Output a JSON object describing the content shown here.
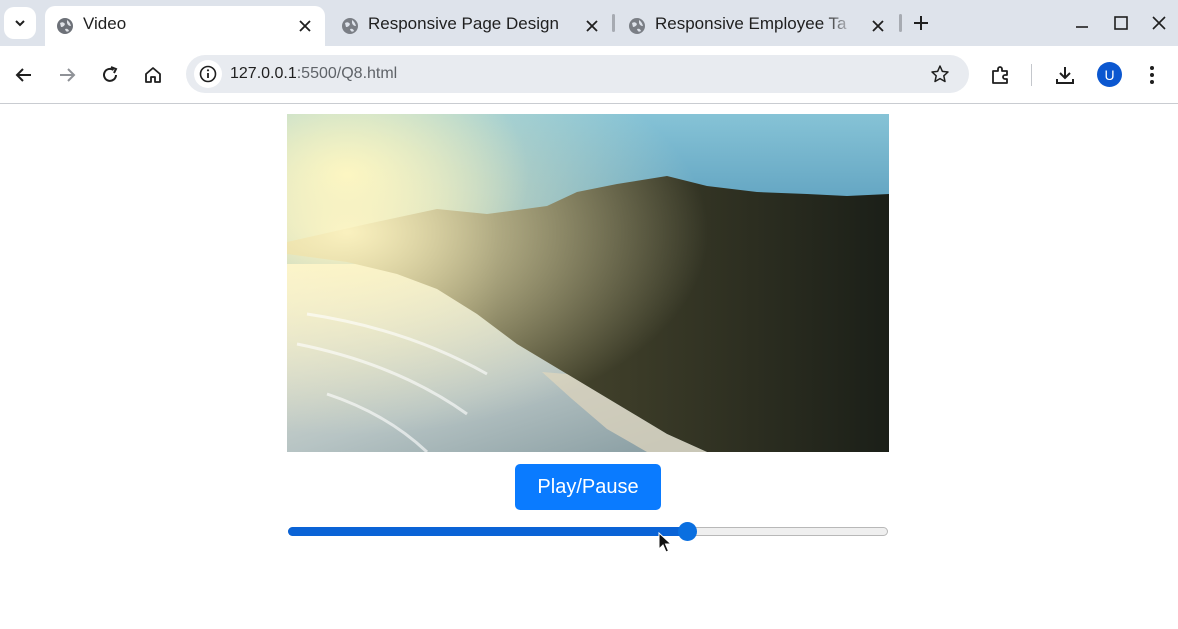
{
  "browser": {
    "tabs": [
      {
        "title": "Video",
        "active": true
      },
      {
        "title": "Responsive Page Design",
        "active": false
      },
      {
        "title": "Responsive Employee Ta",
        "active": false
      }
    ],
    "url_host": "127.0.0.1",
    "url_rest": ":5500/Q8.html",
    "profile_initial": "U"
  },
  "page": {
    "play_button_label": "Play/Pause",
    "seek_progress_percent": 66.5
  },
  "colors": {
    "accent": "#0a7bff",
    "slider_fill": "#0a63d6",
    "tab_strip": "#dee3eb",
    "avatar": "#0b57d0"
  },
  "icons": [
    "tab-search-icon",
    "globe-icon",
    "close-icon",
    "new-tab-icon",
    "minimize-icon",
    "maximize-icon",
    "window-close-icon",
    "back-arrow-icon",
    "forward-arrow-icon",
    "reload-icon",
    "home-icon",
    "site-info-icon",
    "bookmark-star-icon",
    "extensions-icon",
    "download-icon",
    "kebab-menu-icon",
    "mouse-cursor-icon"
  ]
}
